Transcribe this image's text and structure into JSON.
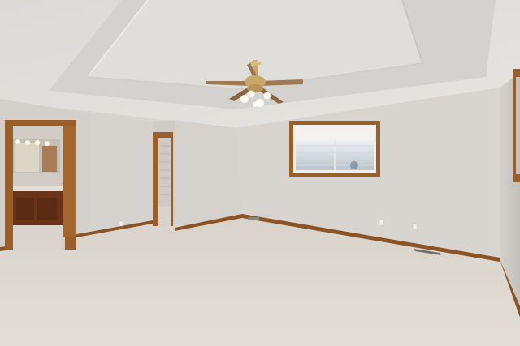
{
  "scene": {
    "type": "photo",
    "subject": "empty-bedroom-interior",
    "elements": [
      "tray-ceiling",
      "ceiling-fan-with-light-kit",
      "horizontal-window",
      "doorway-to-bathroom",
      "doorway-to-closet",
      "carpet-floor",
      "wood-baseboards",
      "floor-vent",
      "wall-outlets",
      "partial-right-window"
    ]
  },
  "colors": {
    "wall": "#d9d6d1",
    "wall_shadow": "#c9c6c1",
    "ceiling": "#e3e1de",
    "ceiling_tray": "#d6d4d1",
    "carpet": "#dcd8cf",
    "wood_trim": "#9a5e2a",
    "cabinet": "#6a3418",
    "fan_blade": "#a07a52",
    "fan_brass": "#c9a86a"
  }
}
